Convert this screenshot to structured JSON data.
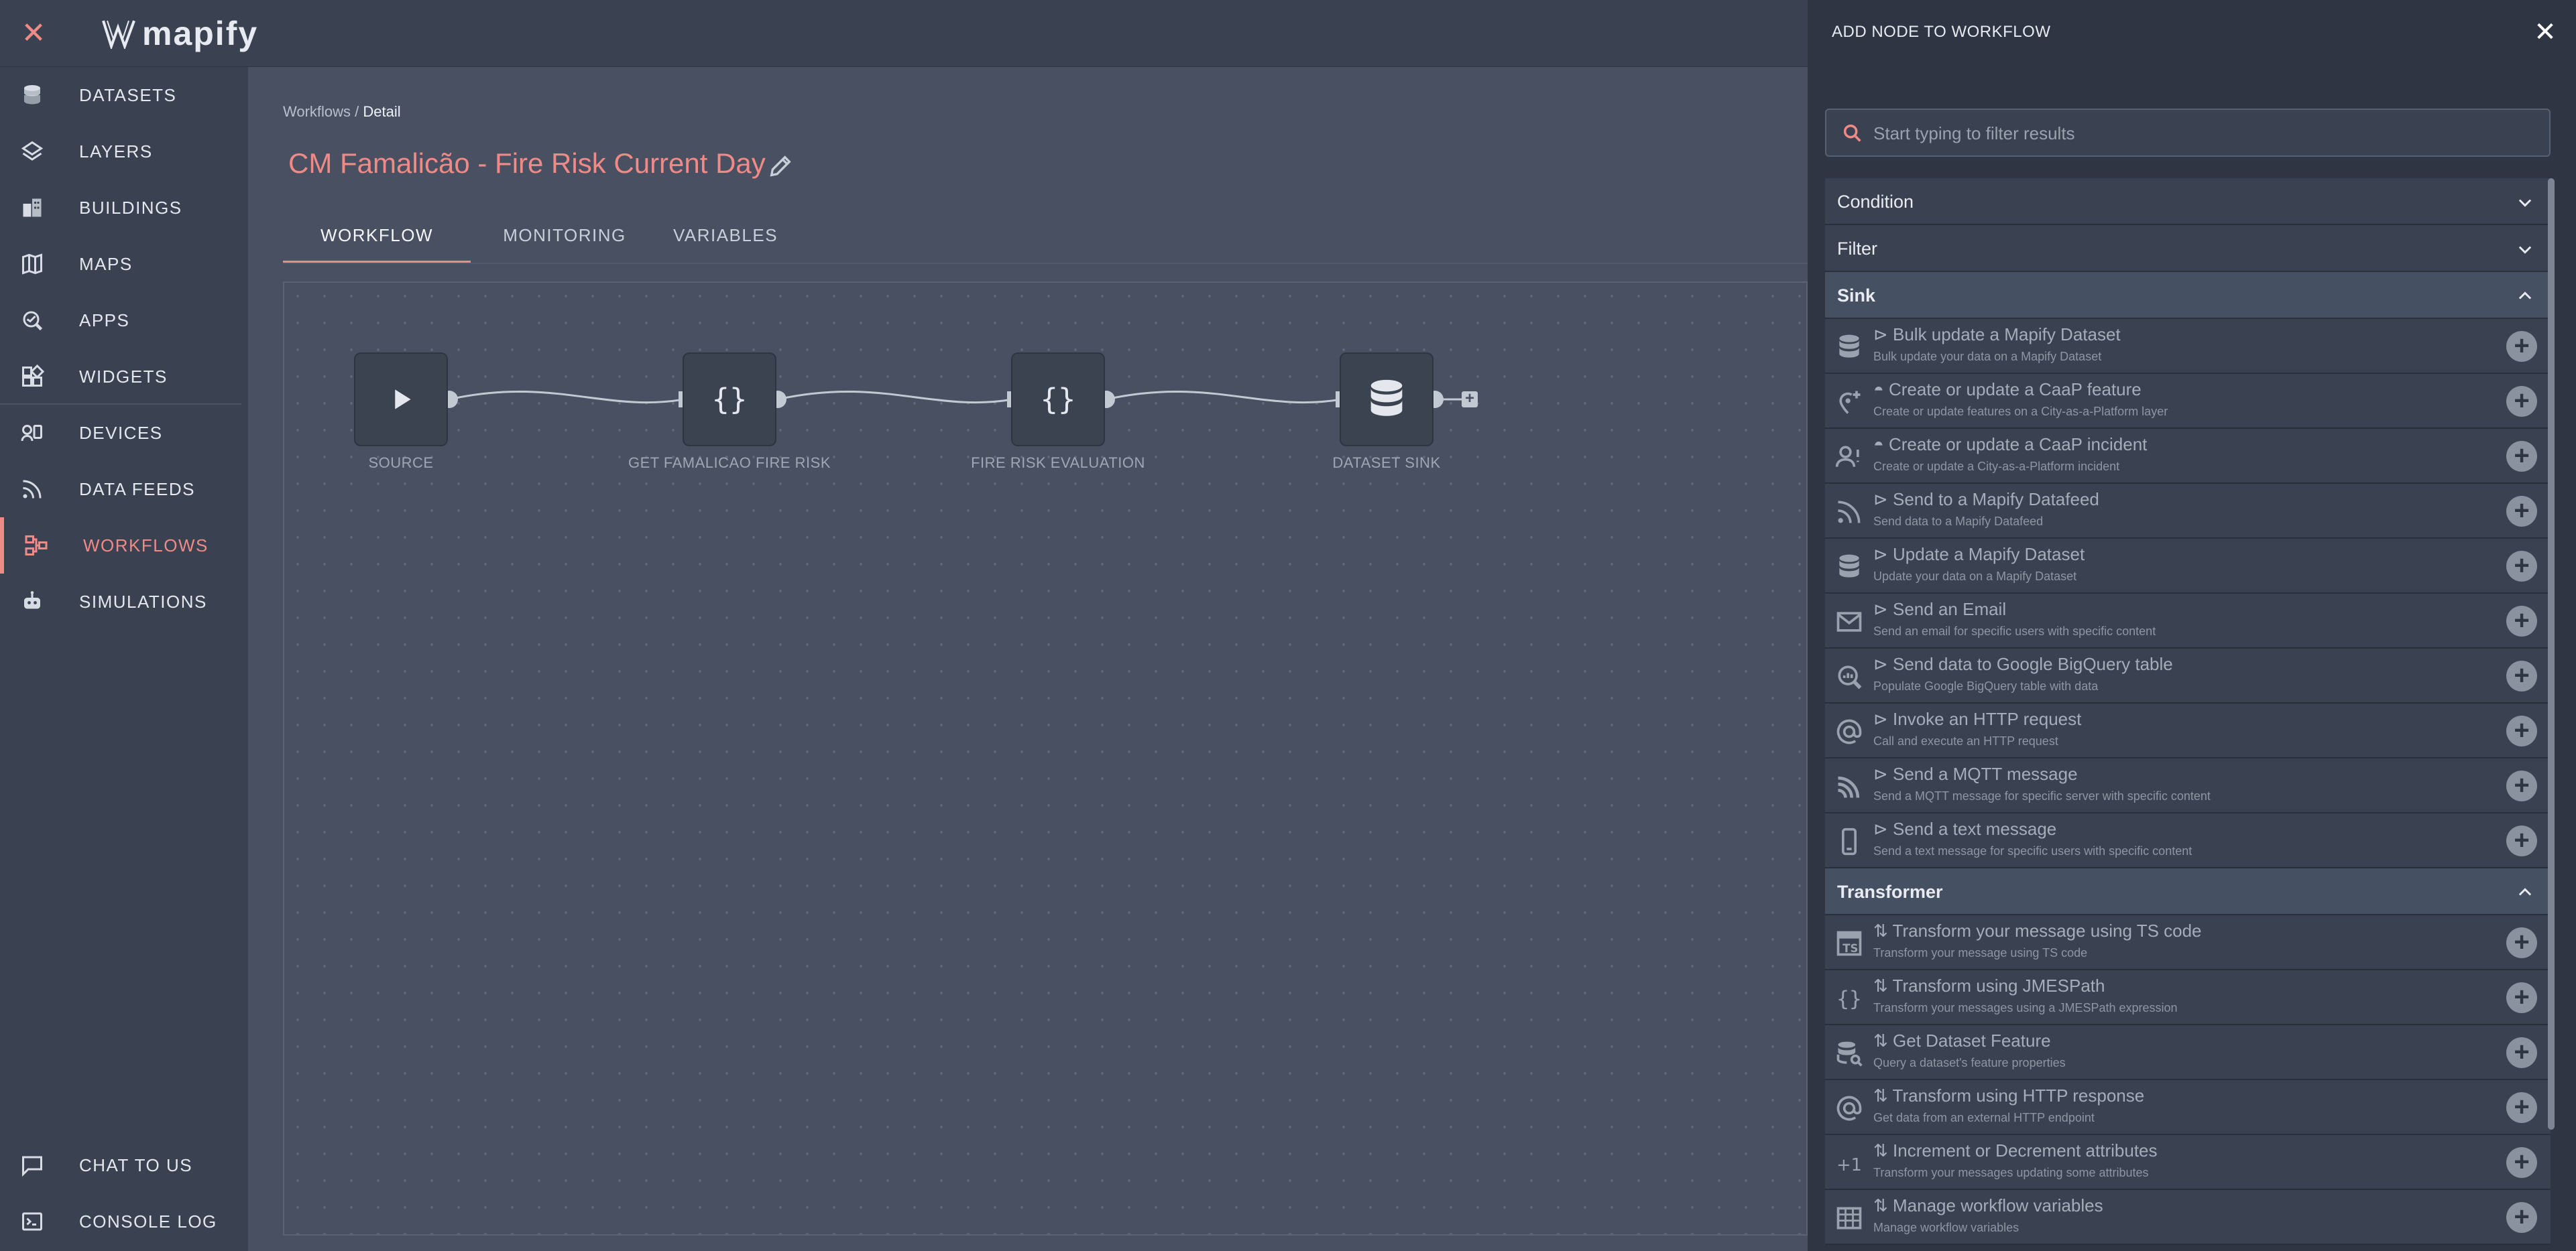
{
  "app": {
    "brand": "mapify",
    "close_glyph": "✕"
  },
  "sidebar": {
    "items": [
      {
        "label": "DATASETS",
        "icon": "database-icon"
      },
      {
        "label": "LAYERS",
        "icon": "layers-icon"
      },
      {
        "label": "BUILDINGS",
        "icon": "buildings-icon"
      },
      {
        "label": "MAPS",
        "icon": "map-icon"
      },
      {
        "label": "APPS",
        "icon": "apps-icon"
      },
      {
        "label": "WIDGETS",
        "icon": "widgets-icon"
      },
      {
        "label": "DEVICES",
        "icon": "devices-icon"
      },
      {
        "label": "DATA FEEDS",
        "icon": "rss-icon"
      },
      {
        "label": "WORKFLOWS",
        "icon": "workflow-icon",
        "active": true
      },
      {
        "label": "SIMULATIONS",
        "icon": "robot-icon"
      }
    ],
    "bottom": [
      {
        "label": "CHAT TO US",
        "icon": "chat-icon"
      },
      {
        "label": "CONSOLE LOG",
        "icon": "console-icon"
      }
    ]
  },
  "breadcrumb": {
    "parent": "Workflows",
    "separator": " / ",
    "current": "Detail"
  },
  "page": {
    "title": "CM Famalicão - Fire Risk Current Day"
  },
  "tabs": [
    {
      "label": "WORKFLOW",
      "active": true
    },
    {
      "label": "MONITORING"
    },
    {
      "label": "VARIABLES"
    }
  ],
  "workflow": {
    "nodes": [
      {
        "label": "SOURCE",
        "icon": "play-icon"
      },
      {
        "label": "GET FAMALICAO FIRE RISK",
        "icon": "braces-icon"
      },
      {
        "label": "FIRE RISK EVALUATION",
        "icon": "braces-icon"
      },
      {
        "label": "DATASET SINK",
        "icon": "database-icon"
      }
    ]
  },
  "panel": {
    "title": "ADD NODE TO WORKFLOW",
    "close_glyph": "✕",
    "search_placeholder": "Start typing to filter results",
    "categories": {
      "condition": "Condition",
      "filter": "Filter",
      "sink": "Sink",
      "transformer": "Transformer"
    },
    "sink_items": [
      {
        "title": "⊳ Bulk update a Mapify Dataset",
        "desc": "Bulk update your data on a Mapify Dataset",
        "icon": "database-icon"
      },
      {
        "title": "Create or update a CaaP feature",
        "desc": "Create or update features on a City-as-a-Platform layer",
        "icon": "add-location-icon"
      },
      {
        "title": "Create or update a CaaP incident",
        "desc": "Create or update a City-as-a-Platform incident",
        "icon": "person-alert-icon"
      },
      {
        "title": "⊳ Send to a Mapify Datafeed",
        "desc": "Send data to a Mapify Datafeed",
        "icon": "rss-icon"
      },
      {
        "title": "⊳ Update a Mapify Dataset",
        "desc": "Update your data on a Mapify Dataset",
        "icon": "database-icon"
      },
      {
        "title": "⊳ Send an Email",
        "desc": "Send an email for specific users with specific content",
        "icon": "mail-icon"
      },
      {
        "title": "⊳ Send data to Google BigQuery table",
        "desc": "Populate Google BigQuery table with data",
        "icon": "bigquery-icon"
      },
      {
        "title": "⊳ Invoke an HTTP request",
        "desc": "Call and execute an HTTP request",
        "icon": "at-icon"
      },
      {
        "title": "⊳ Send a MQTT message",
        "desc": "Send a MQTT message for specific server with specific content",
        "icon": "mqtt-icon"
      },
      {
        "title": "⊳ Send a text message",
        "desc": "Send a text message for specific users with specific content",
        "icon": "phone-icon"
      }
    ],
    "transformer_items": [
      {
        "title": "⇅ Transform your message using TS code",
        "desc": "Transform your message using TS code",
        "icon": "ts-icon"
      },
      {
        "title": "⇅ Transform using JMESPath",
        "desc": "Transform your messages using a JMESPath expression",
        "icon": "braces-icon"
      },
      {
        "title": "⇅ Get Dataset Feature",
        "desc": "Query a dataset's feature properties",
        "icon": "database-search-icon"
      },
      {
        "title": "⇅ Transform using HTTP response",
        "desc": "Get data from an external HTTP endpoint",
        "icon": "at-icon"
      },
      {
        "title": "⇅ Increment or Decrement attributes",
        "desc": "Transform your messages updating some attributes",
        "icon": "plus-one-icon"
      },
      {
        "title": "⇅ Manage workflow variables",
        "desc": "Manage workflow variables",
        "icon": "table-icon"
      }
    ],
    "add_glyph": "+"
  },
  "colors": {
    "accent": "#f08a86",
    "panel_bg": "#2f3542",
    "sidebar_bg": "#3a4150",
    "canvas_bg": "#485061"
  }
}
